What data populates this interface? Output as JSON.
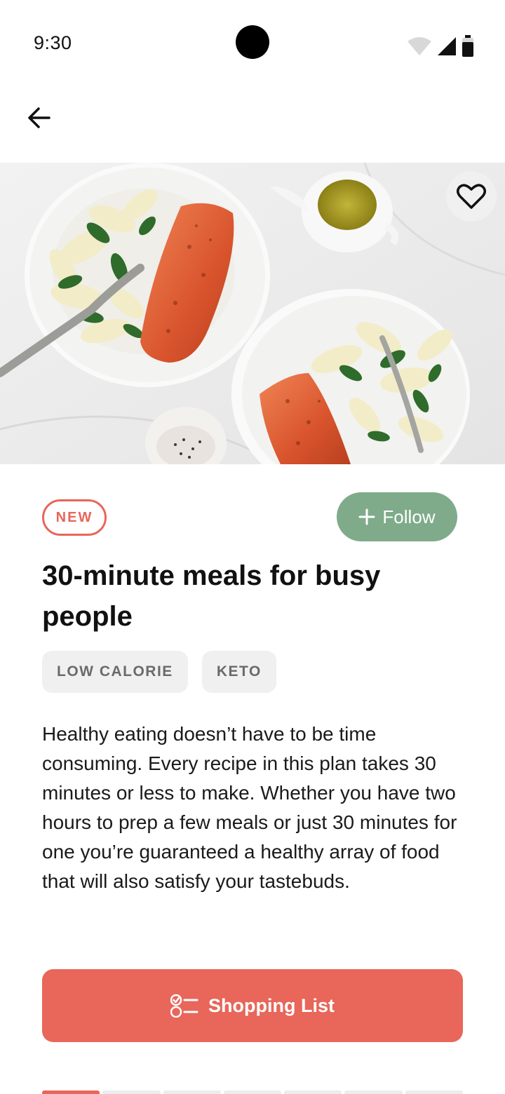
{
  "status_bar": {
    "time": "9:30"
  },
  "plan": {
    "badge": "NEW",
    "follow_label": "Follow",
    "title": "30-minute meals for busy people",
    "tags": [
      "LOW CALORIE",
      "KETO"
    ],
    "description": "Healthy eating doesn’t have to be time consuming. Every recipe in this plan takes 30 minutes or less to make. Whether you have two hours to prep a few meals or just 30 minutes for one you’re guaranteed a healthy array of food that will also satisfy your tastebuds."
  },
  "actions": {
    "shopping_list_label": "Shopping List"
  },
  "colors": {
    "accent": "#e8665a",
    "follow": "#7fab8b",
    "tag_bg": "#f0f0f0"
  },
  "icons": [
    "back-arrow-icon",
    "heart-icon",
    "plus-icon",
    "checklist-icon",
    "wifi-icon",
    "signal-icon",
    "battery-icon"
  ]
}
